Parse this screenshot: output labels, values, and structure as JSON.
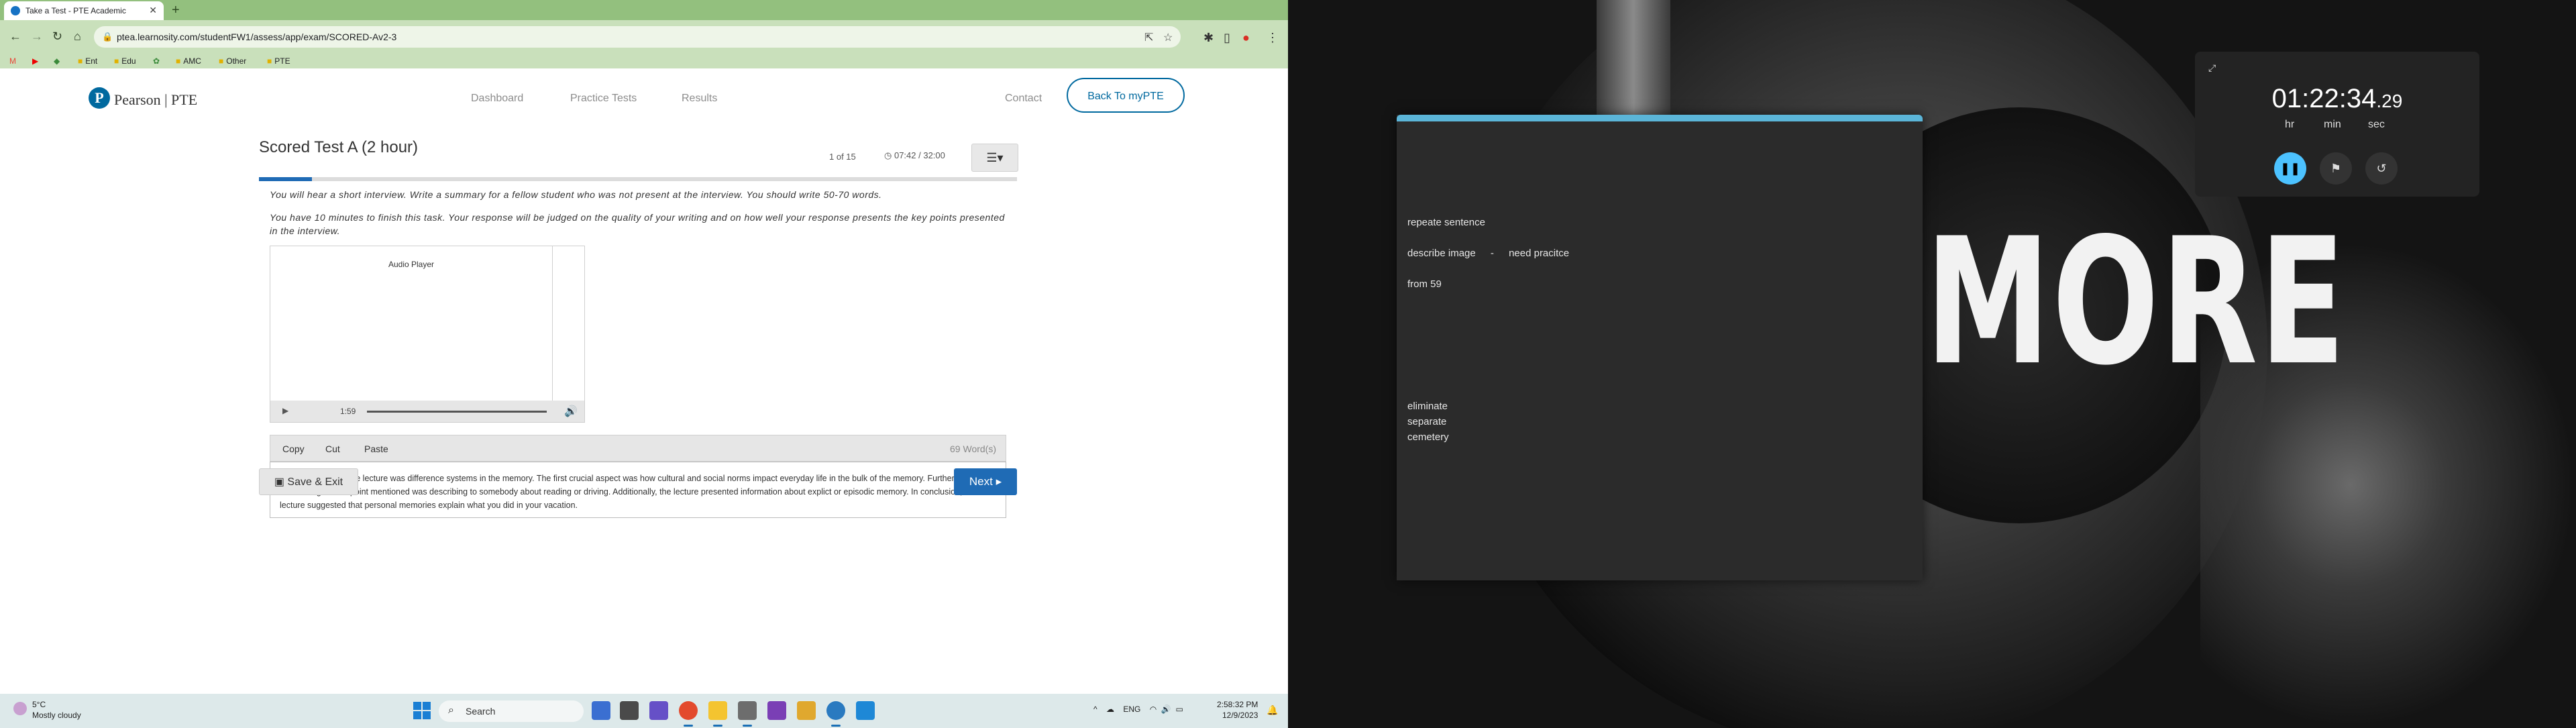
{
  "browser": {
    "tab_title": "Take a Test - PTE Academic",
    "url": "ptea.learnosity.com/studentFW1/assess/app/exam/SCORED-Av2-3",
    "bookmarks": [
      "Ent",
      "Edu",
      "AMC",
      "Other",
      "PTE"
    ]
  },
  "site": {
    "brand": "Pearson | PTE",
    "nav": [
      "Dashboard",
      "Practice Tests",
      "Results"
    ],
    "contact": "Contact",
    "back_button": "Back To myPTE",
    "test_title": "Scored Test A (2 hour)",
    "question_count": "1 of 15",
    "timer": "07:42 / 32:00",
    "progress": 0.07,
    "instruction_1": "You will hear a short interview. Write a summary for a fellow student who was not present at the interview. You should write 50-70 words.",
    "instruction_2": "You have 10 minutes to finish this task. Your response will be judged on the quality of your writing and on how well your response presents the key points presented in the interview.",
    "audio_title": "Audio Player",
    "audio_time": "1:59",
    "toolbar": {
      "copy": "Copy",
      "cut": "Cut",
      "paste": "Paste"
    },
    "word_count": "69 Word(s)",
    "response": "The main focus of the lecture was difference systems in the memory. The first crucial aspect was how cultural and social norms impact everyday life in the bulk of the memory. Furthermore, another significant point mentioned was describing to somebody about reading or driving. Additionally, the lecture presented information about explict or episodic memory. In conclusion, the lecture suggested that personal memories explain what you did in your vacation.",
    "save_exit": "Save & Exit",
    "next": "Next"
  },
  "taskbar": {
    "weather_temp": "5°C",
    "weather_desc": "Mostly cloudy",
    "search": "Search",
    "lang": "ENG",
    "time": "2:58:32 PM",
    "date": "12/9/2023"
  },
  "notes": {
    "line1": "repeate sentence",
    "line2_a": "describe image",
    "line2_sep": "-",
    "line2_b": "need pracitce",
    "line3": "from 59",
    "words": [
      "eliminate",
      "separate",
      "cemetery"
    ]
  },
  "stopwatch": {
    "main": "01:22:34",
    "fraction": ".29",
    "units": [
      "hr",
      "min",
      "sec"
    ]
  },
  "wallpaper": {
    "text": "MORE"
  },
  "colors": {
    "accent": "#1f6bb5",
    "brand": "#00699f",
    "stopwatch_accent": "#4cc2ff",
    "notes_accent": "#5bb5d8"
  }
}
